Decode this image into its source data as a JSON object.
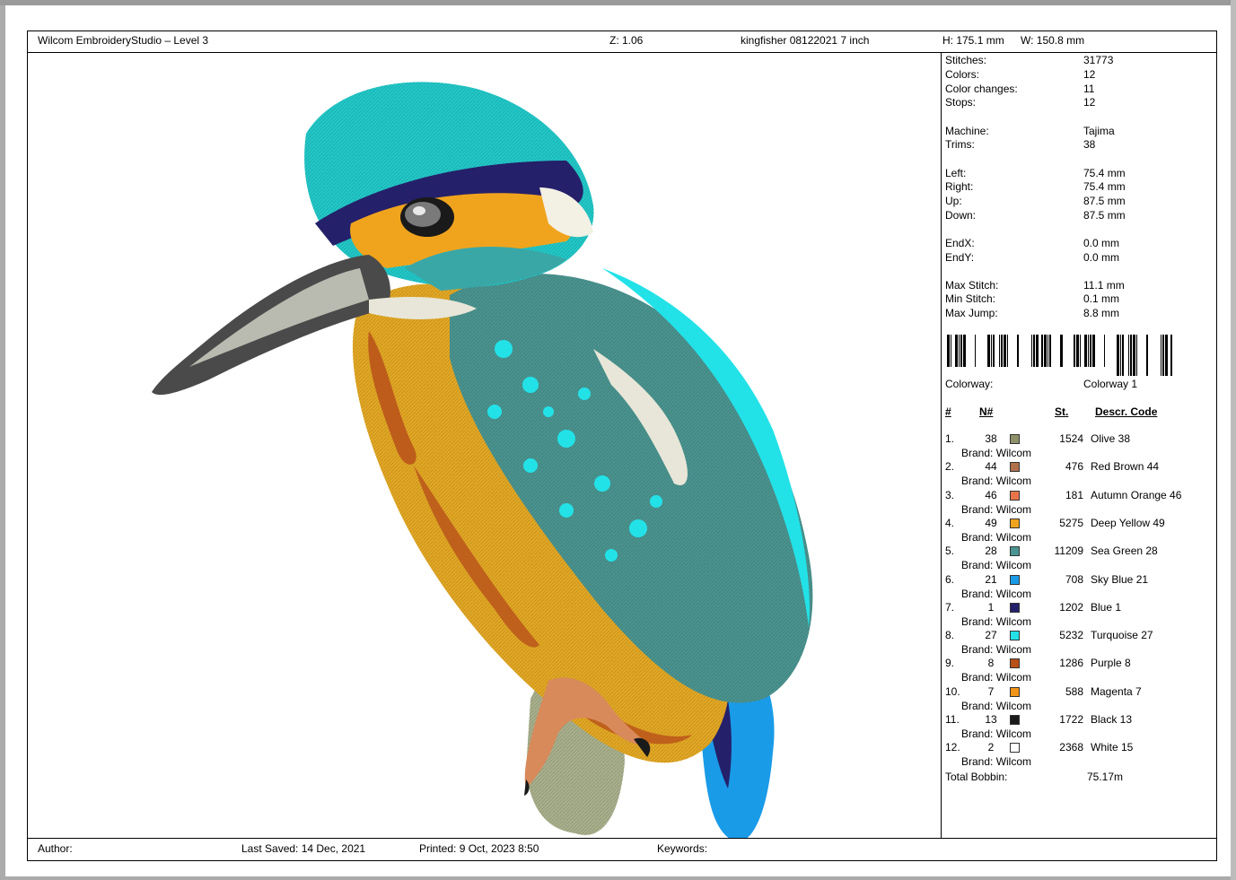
{
  "header": {
    "app_title": "Wilcom EmbroideryStudio – Level 3",
    "zoom": "Z: 1.06",
    "design_name": "kingfisher 08122021 7 inch",
    "height": "H: 175.1 mm",
    "width": "W: 150.8 mm"
  },
  "stats": {
    "stitches_label": "Stitches:",
    "stitches": "31773",
    "colors_label": "Colors:",
    "colors": "12",
    "color_changes_label": "Color changes:",
    "color_changes": "11",
    "stops_label": "Stops:",
    "stops": "12",
    "machine_label": "Machine:",
    "machine": "Tajima",
    "trims_label": "Trims:",
    "trims": "38",
    "left_label": "Left:",
    "left": "75.4 mm",
    "right_label": "Right:",
    "right": "75.4 mm",
    "up_label": "Up:",
    "up": "87.5 mm",
    "down_label": "Down:",
    "down": "87.5 mm",
    "endx_label": "EndX:",
    "endx": "0.0 mm",
    "endy_label": "EndY:",
    "endy": "0.0 mm",
    "max_stitch_label": "Max Stitch:",
    "max_stitch": "11.1 mm",
    "min_stitch_label": "Min Stitch:",
    "min_stitch": "0.1 mm",
    "max_jump_label": "Max Jump:",
    "max_jump": "8.8 mm",
    "colorway_label": "Colorway:",
    "colorway": "Colorway 1"
  },
  "table_headers": {
    "index": "#",
    "n": "N#",
    "st": "St.",
    "descr": "Descr. Code"
  },
  "threads": [
    {
      "index": "1.",
      "n": "38",
      "color": "#8f8f6a",
      "st": "1524",
      "descr": "Olive 38",
      "brand": "Brand: Wilcom"
    },
    {
      "index": "2.",
      "n": "44",
      "color": "#b0704a",
      "st": "476",
      "descr": "Red Brown 44",
      "brand": "Brand: Wilcom"
    },
    {
      "index": "3.",
      "n": "46",
      "color": "#e8754a",
      "st": "181",
      "descr": "Autumn Orange 46",
      "brand": "Brand: Wilcom"
    },
    {
      "index": "4.",
      "n": "49",
      "color": "#f0a41e",
      "st": "5275",
      "descr": "Deep Yellow 49",
      "brand": "Brand: Wilcom"
    },
    {
      "index": "5.",
      "n": "28",
      "color": "#4a9490",
      "st": "11209",
      "descr": "Sea Green 28",
      "brand": "Brand: Wilcom"
    },
    {
      "index": "6.",
      "n": "21",
      "color": "#1a9be8",
      "st": "708",
      "descr": "Sky Blue 21",
      "brand": "Brand: Wilcom"
    },
    {
      "index": "7.",
      "n": "1",
      "color": "#25206a",
      "st": "1202",
      "descr": "Blue 1",
      "brand": "Brand: Wilcom"
    },
    {
      "index": "8.",
      "n": "27",
      "color": "#22e2e8",
      "st": "5232",
      "descr": "Turquoise 27",
      "brand": "Brand: Wilcom"
    },
    {
      "index": "9.",
      "n": "8",
      "color": "#b8501a",
      "st": "1286",
      "descr": "Purple 8",
      "brand": "Brand: Wilcom"
    },
    {
      "index": "10.",
      "n": "7",
      "color": "#f29418",
      "st": "588",
      "descr": "Magenta 7",
      "brand": "Brand: Wilcom"
    },
    {
      "index": "11.",
      "n": "13",
      "color": "#1a1a1a",
      "st": "1722",
      "descr": "Black 13",
      "brand": "Brand: Wilcom"
    },
    {
      "index": "12.",
      "n": "2",
      "color": "#ffffff",
      "st": "2368",
      "descr": "White 15",
      "brand": "Brand: Wilcom"
    }
  ],
  "total_bobbin_label": "Total Bobbin:",
  "total_bobbin": "75.17m",
  "footer": {
    "author": "Author:",
    "last_saved": "Last Saved: 14 Dec, 2021",
    "printed": "Printed:  9 Oct, 2023  8:50",
    "keywords": "Keywords:"
  },
  "design_image": "embroidered kingfisher bird perched on a branch"
}
